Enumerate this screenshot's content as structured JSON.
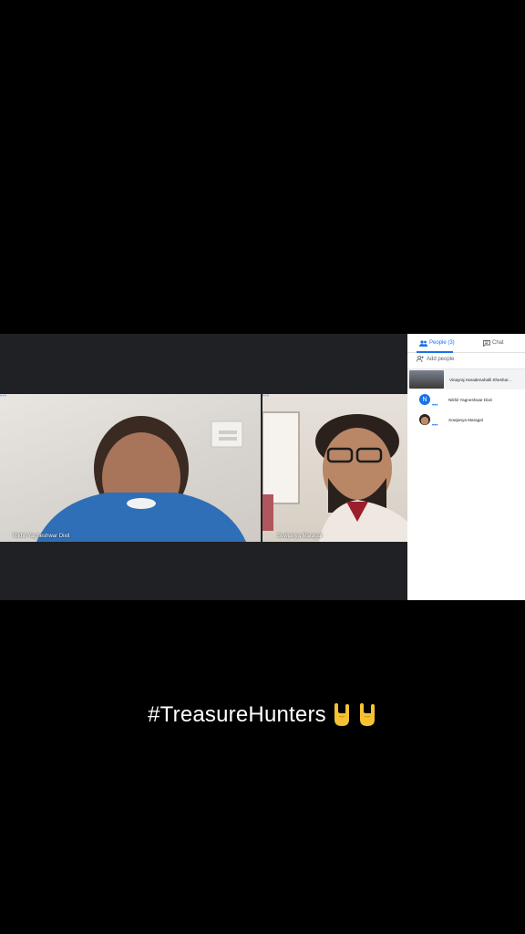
{
  "panel": {
    "tabs": [
      {
        "label": "People (3)",
        "icon": "people-icon"
      },
      {
        "label": "Chat",
        "icon": "chat-icon"
      }
    ],
    "add_people_label": "Add people",
    "participants": [
      {
        "name": "Vinayraj Haradenahalli Sheshar..."
      },
      {
        "name": "Nikhil Yagneshwar Dixit",
        "initial": "N"
      },
      {
        "name": "Sowjanya Maragal"
      }
    ]
  },
  "tiles": [
    {
      "name": "Nikhil Yagneshwar Dixit"
    },
    {
      "name": "Sowjanya Maragal"
    }
  ],
  "caption": "#TreasureHunters",
  "colors": {
    "accent": "#1a73e8",
    "meet_bg": "#202124"
  }
}
